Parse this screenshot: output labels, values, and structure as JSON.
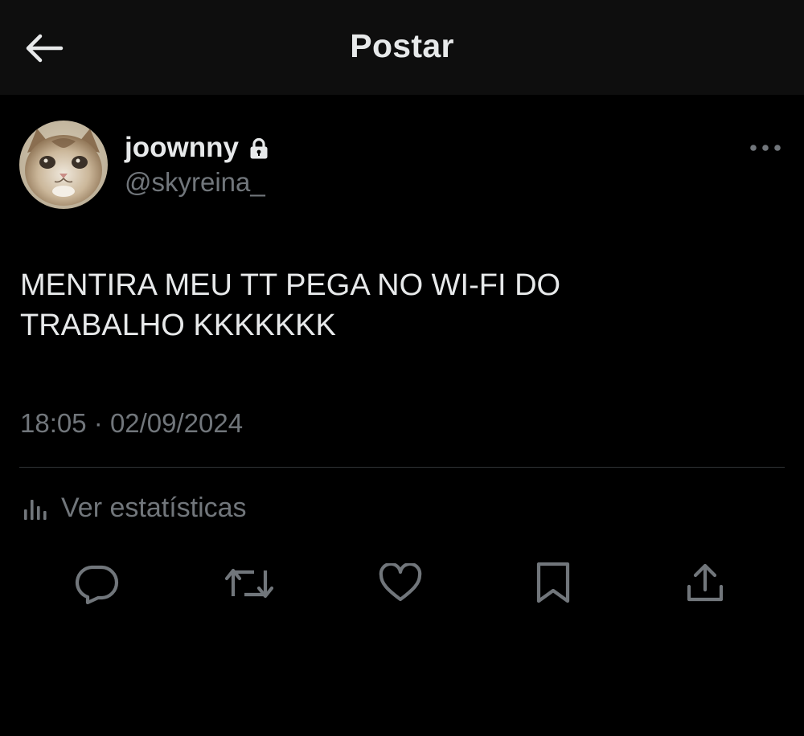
{
  "header": {
    "title": "Postar",
    "back_icon": "arrow-left-icon"
  },
  "author": {
    "display_name": "joownny",
    "handle": "@skyreina_",
    "protected_icon": "lock-icon",
    "avatar": "cat-avatar"
  },
  "post": {
    "text_lines": [
      "MENTIRA MEU TT PEGA NO WI-FI DO",
      "TRABALHO KKKKKKK"
    ],
    "time": "18:05",
    "separator": "·",
    "date": "02/09/2024"
  },
  "stats": {
    "label": "Ver estatísticas",
    "icon": "analytics-icon"
  },
  "actions": [
    {
      "name": "reply",
      "icon": "reply-icon"
    },
    {
      "name": "repost",
      "icon": "repost-icon"
    },
    {
      "name": "like",
      "icon": "heart-icon"
    },
    {
      "name": "bookmark",
      "icon": "bookmark-icon"
    },
    {
      "name": "share",
      "icon": "share-icon"
    }
  ],
  "colors": {
    "background": "#000000",
    "header_background": "#0e0e0e",
    "text_primary": "#e7e9ea",
    "text_secondary": "#71767b",
    "divider": "#2f3336"
  }
}
